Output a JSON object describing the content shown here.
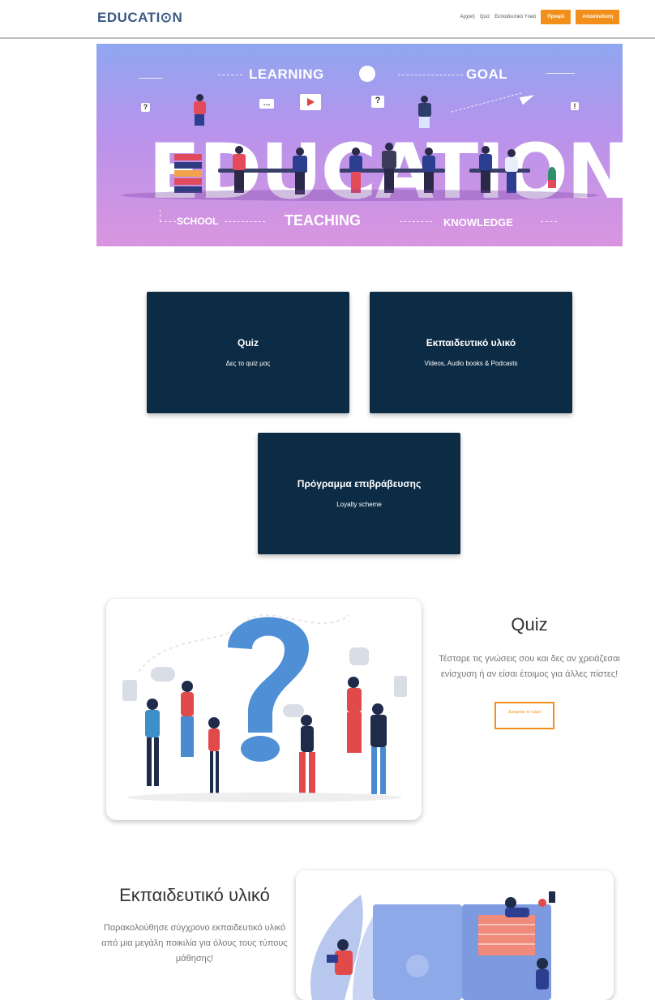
{
  "header": {
    "logo": "EDUCATI⊙N",
    "nav": [
      "Αρχική",
      "Quiz",
      "Εκπαιδευτικό Υλικό"
    ],
    "btn_login": "Προφίλ",
    "btn_register": "Αποσύνδεση"
  },
  "hero": {
    "learning": "LEARNING",
    "goal": "GOAL",
    "big": "EDUCATION",
    "school": "SCHOOL",
    "teaching": "TEACHING",
    "knowledge": "KNOWLEDGE"
  },
  "cards": [
    {
      "title": "Quiz",
      "sub": "Δες το quiz μας"
    },
    {
      "title": "Εκπαιδευτικό υλικό",
      "sub": "Videos, Audio books & Podcasts"
    },
    {
      "title": "Πρόγραμμα επιβράβευσης",
      "sub": "Loyalty scheme"
    }
  ],
  "quiz_section": {
    "title": "Quiz",
    "text": "Τέσταρε τις γνώσεις σου και δες αν χρειάζεσαι ενίσχυση ή αν είσαι έτοιμος για άλλες πίστες!",
    "button": "Δοκίμασε το τώρα"
  },
  "material_section": {
    "title": "Εκπαιδευτικό υλικό",
    "text": "Παρακολούθησε σύγχρονο εκπαιδευτικό υλικό από μια μεγάλη ποικιλία για όλους τους τύπους μάθησης!"
  },
  "colors": {
    "accent": "#f18f1a",
    "card": "#0c2b44",
    "logo": "#3c5a85"
  }
}
